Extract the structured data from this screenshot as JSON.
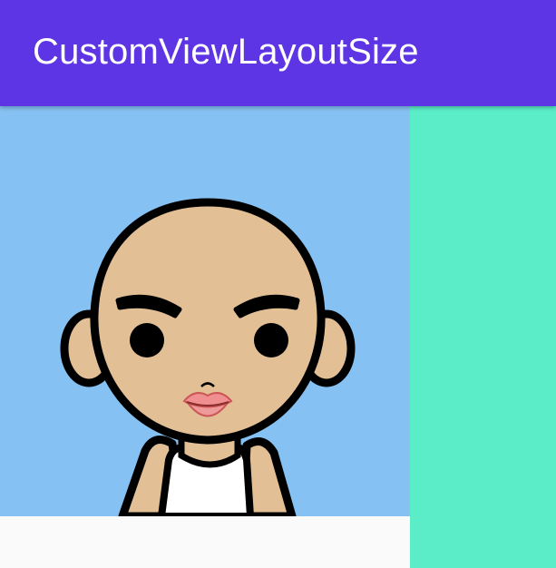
{
  "app_bar": {
    "title": "CustomViewLayoutSize",
    "color": "#5e35e5"
  },
  "custom_view": {
    "background": "#85c1f2",
    "image": "avatar-illustration"
  },
  "side_panel": {
    "color": "#5becc8"
  },
  "colors": {
    "skin": "#e3bf96",
    "outline": "#000000",
    "lips": "#f08f8f",
    "shirt": "#ffffff"
  }
}
